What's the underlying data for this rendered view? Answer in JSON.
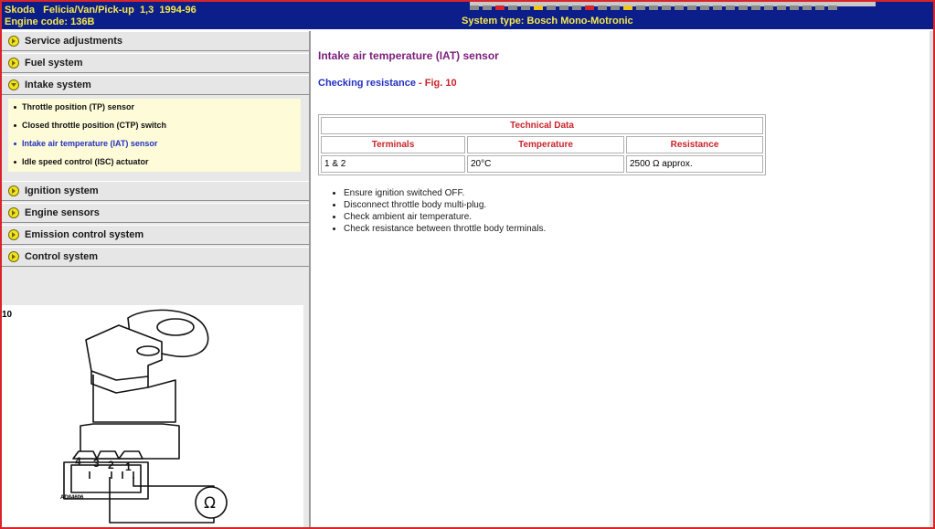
{
  "header": {
    "vehicle": "Skoda   Felicia/Van/Pick-up  1,3  1994-96",
    "engine_code": "Engine code: 136B",
    "system_type": "System type: Bosch Mono-Motronic"
  },
  "menu": {
    "items": [
      {
        "label": "Service adjustments"
      },
      {
        "label": "Fuel system"
      },
      {
        "label": "Intake system"
      },
      {
        "label": "Ignition system"
      },
      {
        "label": "Engine sensors"
      },
      {
        "label": "Emission control system"
      },
      {
        "label": "Control system"
      }
    ],
    "intake_subitems": [
      {
        "label": "Throttle position (TP) sensor"
      },
      {
        "label": "Closed throttle position (CTP) switch"
      },
      {
        "label": "Intake air temperature (IAT) sensor"
      },
      {
        "label": "Idle speed control (ISC) actuator"
      }
    ]
  },
  "figure": {
    "number": "10",
    "code": "AD84606",
    "pin_labels": [
      "4",
      "3",
      "2",
      "1"
    ],
    "meter_symbol": "Ω"
  },
  "content": {
    "title": "Intake air temperature (IAT) sensor",
    "subtitle_main": "Checking resistance",
    "subtitle_fig": " - Fig. 10",
    "table": {
      "caption": "Technical Data",
      "headers": [
        "Terminals",
        "Temperature",
        "Resistance"
      ],
      "row": [
        "1 & 2",
        "20°C",
        "2500 Ω approx."
      ]
    },
    "steps": [
      "Ensure ignition switched OFF.",
      "Disconnect throttle body multi-plug.",
      "Check ambient air temperature.",
      "Check resistance between throttle body terminals."
    ]
  },
  "colors": {
    "header_bg": "#0b1e8a",
    "header_text": "#f7e94a",
    "title": "#7b1e7a",
    "accent_red": "#c8232a",
    "link_blue": "#2431c0",
    "frame": "#d8242a"
  }
}
